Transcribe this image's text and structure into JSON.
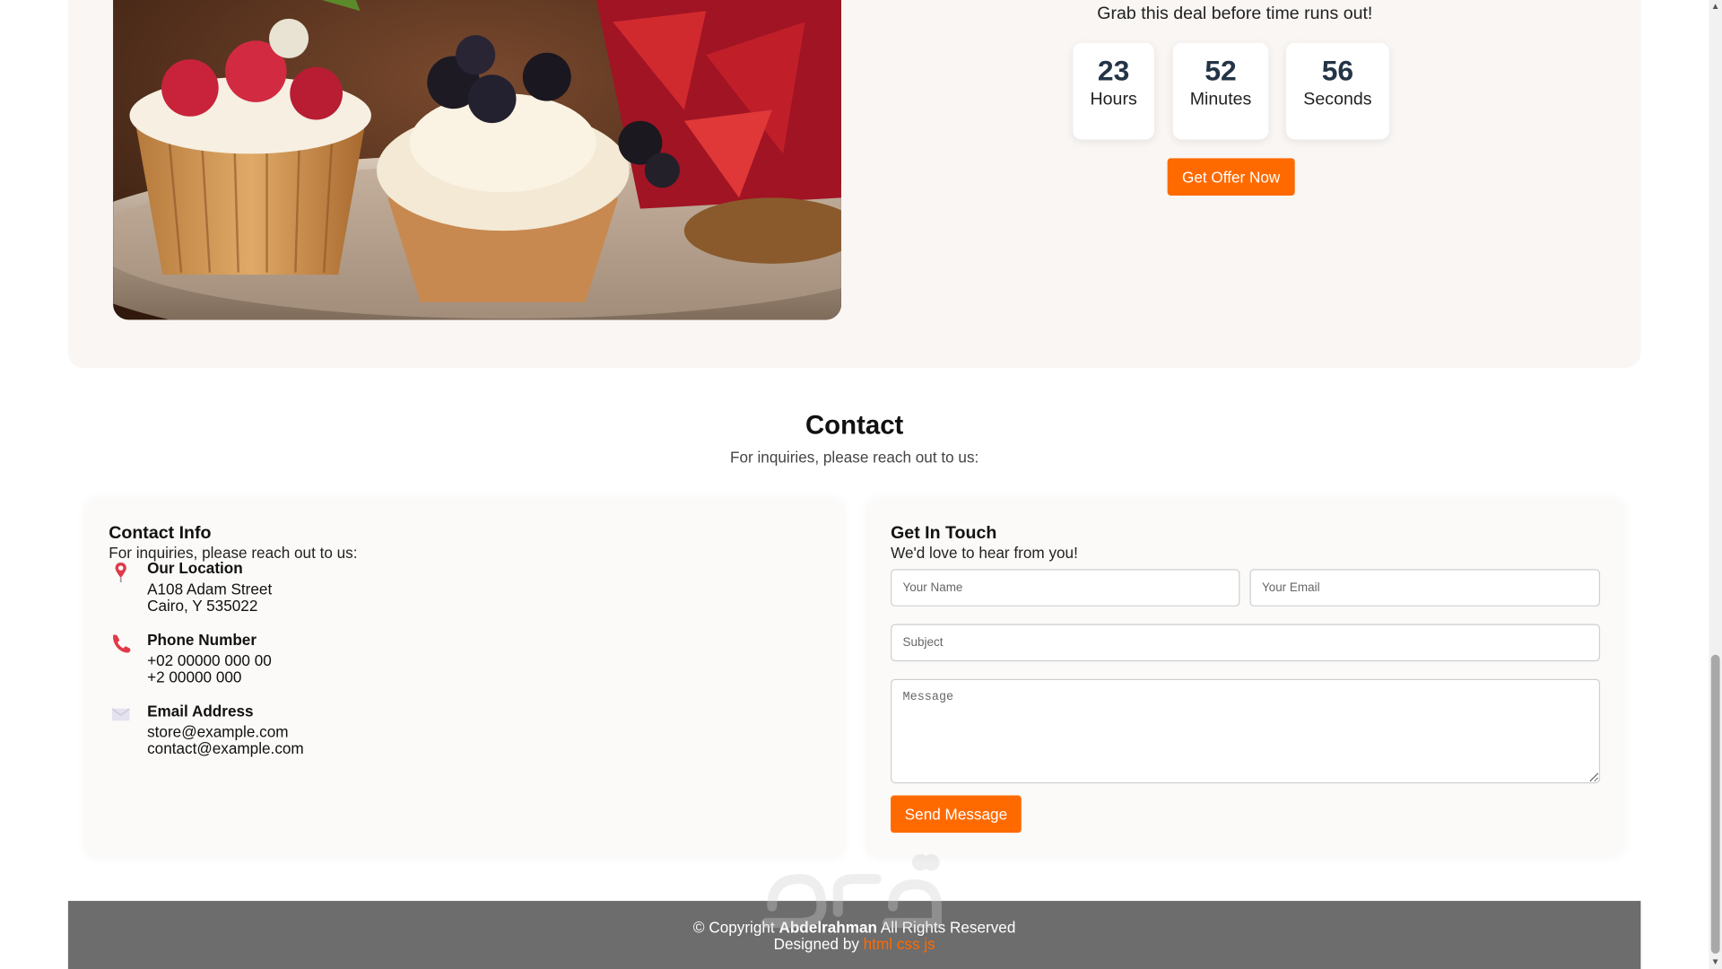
{
  "offer": {
    "deal_text": "Grab this deal before time runs out!",
    "timers": [
      {
        "value": "23",
        "unit": "Hours"
      },
      {
        "value": "52",
        "unit": "Minutes"
      },
      {
        "value": "56",
        "unit": "Seconds"
      }
    ],
    "button_label": "Get Offer Now",
    "image_alt": "Assorted fruit tarts and cupcakes with berries and cream"
  },
  "contact": {
    "title": "Contact",
    "subtitle": "For inquiries, please reach out to us:",
    "info": {
      "heading": "Contact Info",
      "subheading": "For inquiries, please reach out to us:",
      "location": {
        "title": "Our Location",
        "lines": [
          "A108 Adam Street",
          "Cairo, Y 535022"
        ]
      },
      "phone": {
        "title": "Phone Number",
        "lines": [
          "+02 00000 000 00",
          "+2 00000 000"
        ]
      },
      "email": {
        "title": "Email Address",
        "lines": [
          "store@example.com",
          "contact@example.com"
        ]
      }
    },
    "form": {
      "heading": "Get In Touch",
      "subheading": "We'd love to hear from you!",
      "name_placeholder": "Your Name",
      "email_placeholder": "Your Email",
      "subject_placeholder": "Subject",
      "message_placeholder": "Message",
      "submit_label": "Send Message"
    }
  },
  "footer": {
    "copyright_prefix": "© Copyright",
    "author": "Abdelrahman",
    "rights": "All Rights Reserved",
    "designed_by": "Designed by",
    "designer": "html css js"
  },
  "colors": {
    "accent": "#ff6a00",
    "offer_bg": "#f9f6f3",
    "footer_bg": "#6d6d6d",
    "timer_number": "#243447"
  }
}
